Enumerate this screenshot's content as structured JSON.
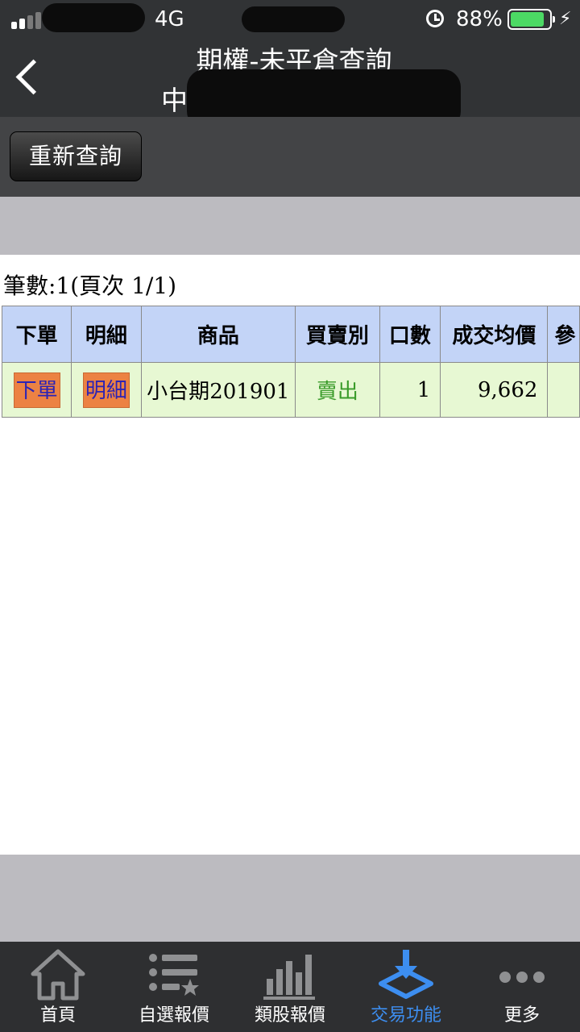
{
  "status_bar": {
    "network": "4G",
    "battery": "88%",
    "battery_level": 0.88
  },
  "header": {
    "title": "期權-未平倉查詢",
    "subtitle": "中"
  },
  "toolbar": {
    "requery_label": "重新查詢"
  },
  "summary": {
    "text": "筆數:1(頁次 1/1)"
  },
  "table": {
    "headers": [
      "下單",
      "明細",
      "商品",
      "買賣別",
      "口數",
      "成交均價",
      "參"
    ],
    "rows": [
      {
        "order": "下單",
        "detail": "明細",
        "product_name": "小台期",
        "product_code": "201901",
        "side": "賣出",
        "quantity": "1",
        "avg_price": "9,662",
        "extra": ""
      }
    ]
  },
  "tabs": [
    {
      "label": "首頁",
      "icon": "home-icon",
      "active": false
    },
    {
      "label": "自選報價",
      "icon": "watchlist-icon",
      "active": false
    },
    {
      "label": "類股報價",
      "icon": "bar-chart-icon",
      "active": false
    },
    {
      "label": "交易功能",
      "icon": "trade-icon",
      "active": true
    },
    {
      "label": "更多",
      "icon": "more-icon",
      "active": false
    }
  ],
  "colors": {
    "header_bg": "#313335",
    "table_header_bg": "#c3d4f7",
    "row_bg": "#e7f8d3",
    "action_button_bg": "#ec8243",
    "sell_text": "#3a9b2a",
    "active_tab": "#3d8ef0"
  }
}
